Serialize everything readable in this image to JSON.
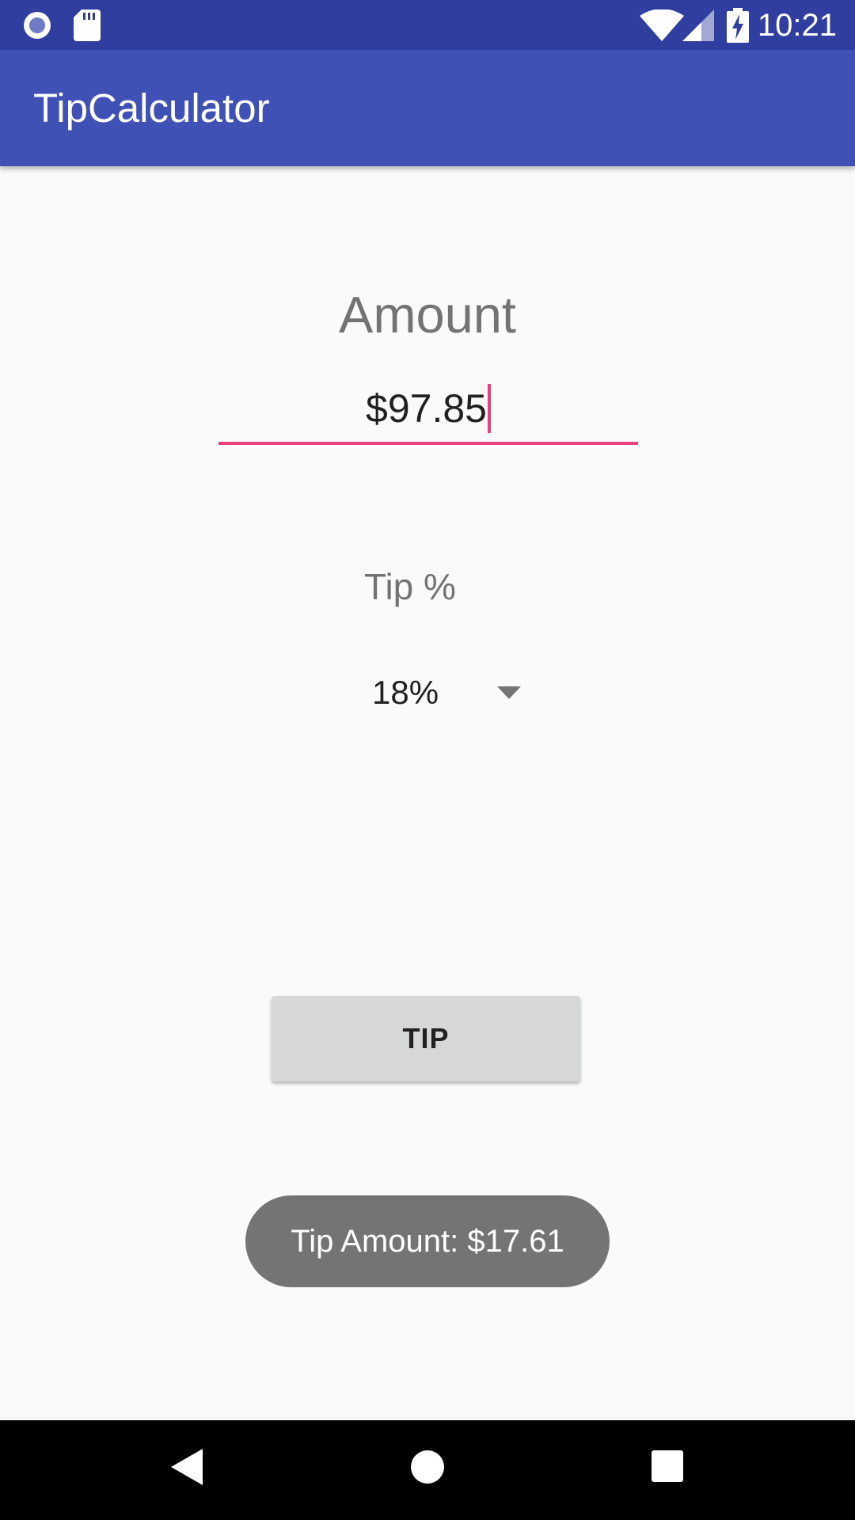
{
  "status_bar": {
    "time": "10:21",
    "icons": [
      "record-icon",
      "sd-card-icon",
      "wifi-icon",
      "signal-icon",
      "battery-charging-icon"
    ]
  },
  "app_bar": {
    "title": "TipCalculator"
  },
  "amount": {
    "label": "Amount",
    "value": "$97.85"
  },
  "tip": {
    "label": "Tip %",
    "selected": "18%"
  },
  "tip_button": {
    "label": "TIP"
  },
  "toast": {
    "text": "Tip Amount: $17.61"
  },
  "nav_bar": {
    "icons": [
      "back-icon",
      "home-icon",
      "recents-icon"
    ]
  },
  "colors": {
    "status_bar": "#303f9f",
    "app_bar": "#3f51b5",
    "accent": "#e8417f",
    "button": "#d6d7d7",
    "toast": "#747474",
    "background": "#fafafa"
  }
}
